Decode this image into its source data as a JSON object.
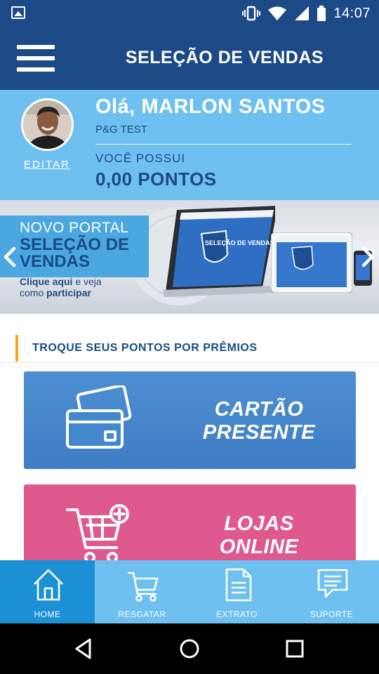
{
  "status_bar": {
    "time": "14:07",
    "icons": [
      "image-notification-icon",
      "vibrate-icon",
      "wifi-icon",
      "signal-icon",
      "battery-icon"
    ]
  },
  "header": {
    "title": "SELEÇÃO DE VENDAS",
    "menu_icon": "hamburger-menu-icon"
  },
  "profile": {
    "greeting": "Olá, MARLON SANTOS",
    "company": "P&G TEST",
    "points_label": "VOCÊ POSSUI",
    "points_value": "0,00 PONTOS",
    "edit_label": "EDITAR"
  },
  "banner": {
    "line1": "NOVO PORTAL",
    "line2": "SELEÇÃO DE VENDAS",
    "line3_prefix": "Clique aqui",
    "line3_mid": " e veja como ",
    "line3_suffix": "participar",
    "screen_text": "SELEÇÃO DE VENDAS"
  },
  "section": {
    "title": "TROQUE SEUS PONTOS POR PRÊMIOS"
  },
  "cards": [
    {
      "line1": "CARTÃO",
      "line2": "PRESENTE",
      "icon": "gift-card-icon",
      "color": "#4387cc"
    },
    {
      "line1": "LOJAS",
      "line2": "ONLINE",
      "icon": "cart-add-icon",
      "color": "#e0598e"
    }
  ],
  "bottom_nav": {
    "items": [
      {
        "label": "HOME",
        "icon": "home-icon",
        "active": true
      },
      {
        "label": "RESGATAR",
        "icon": "cart-icon",
        "active": false
      },
      {
        "label": "EXTRATO",
        "icon": "document-icon",
        "active": false
      },
      {
        "label": "SUPORTE",
        "icon": "chat-icon",
        "active": false
      }
    ]
  },
  "colors": {
    "primary": "#1c4a86",
    "light_blue": "#6ec0f0",
    "active_nav": "#1c90d4",
    "accent": "#f3a91d",
    "pink": "#e0598e"
  }
}
